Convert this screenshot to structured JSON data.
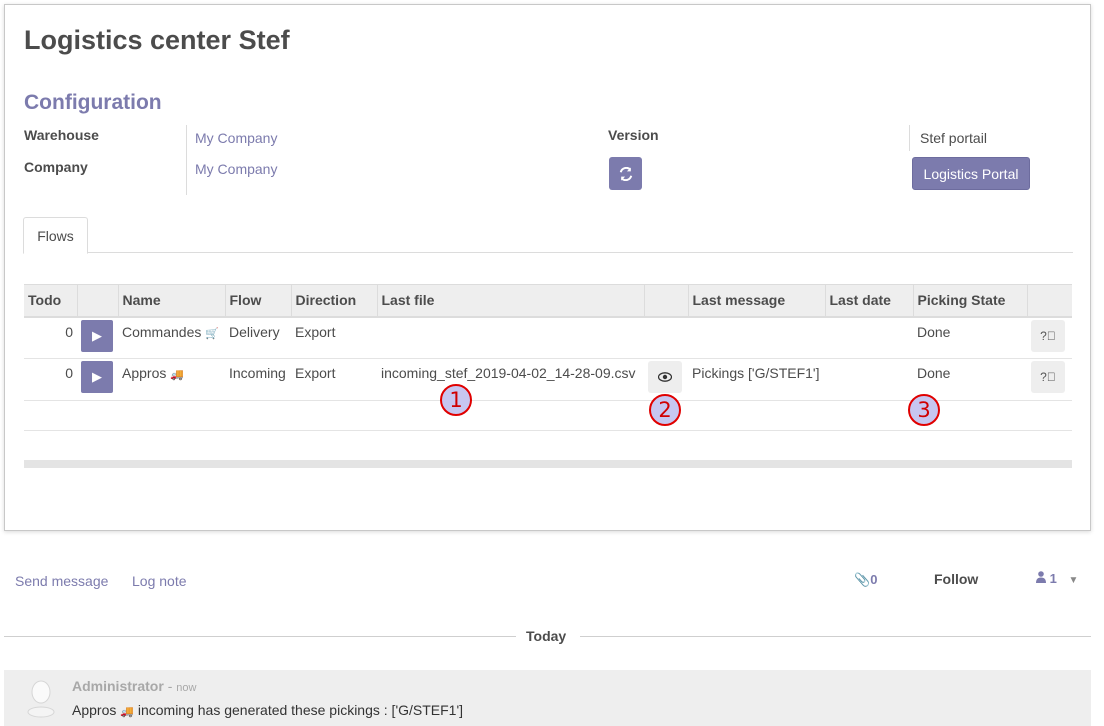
{
  "page": {
    "title": "Logistics center Stef",
    "section_title": "Configuration"
  },
  "config": {
    "warehouse_label": "Warehouse",
    "warehouse_value": "My Company",
    "company_label": "Company",
    "company_value": "My Company",
    "version_label": "Version",
    "portal_label": "Stef portail",
    "portal_button": "Logistics Portal"
  },
  "tabs": [
    {
      "label": "Flows"
    }
  ],
  "table": {
    "headers": [
      "Todo",
      "",
      "Name",
      "Flow",
      "Direction",
      "Last file",
      "",
      "Last message",
      "Last date",
      "Picking State",
      ""
    ],
    "rows": [
      {
        "todo": "0",
        "name": "Commandes",
        "name_icon": "🛒",
        "flow": "Delivery",
        "direction": "Export",
        "last_file": "",
        "last_message": "",
        "last_date": "",
        "picking_state": "Done"
      },
      {
        "todo": "0",
        "name": "Appros",
        "name_icon": "🚚",
        "flow": "Incoming",
        "direction": "Export",
        "last_file": "incoming_stef_2019-04-02_14-28-09.csv",
        "last_message": "Pickings ['G/STEF1']",
        "last_date": "",
        "picking_state": "Done"
      }
    ]
  },
  "annotations": [
    "1",
    "2",
    "3"
  ],
  "chatter": {
    "send_message": "Send message",
    "log_note": "Log note",
    "attachments": "0",
    "follow": "Follow",
    "followers": "1",
    "today": "Today",
    "message": {
      "author": "Administrator",
      "separator": "-",
      "time": "now",
      "text_prefix": "Appros",
      "text_suffix": "incoming has generated these pickings : ['G/STEF1']"
    }
  },
  "colors": {
    "accent": "#7c7bad",
    "annotation_border": "#e00000",
    "annotation_fill": "#c7c6f0"
  }
}
